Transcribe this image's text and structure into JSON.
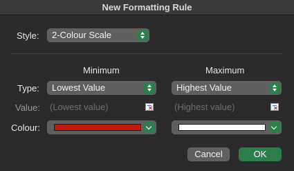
{
  "window": {
    "title": "New Formatting Rule"
  },
  "style": {
    "label": "Style:",
    "value": "2-Colour Scale"
  },
  "columns": {
    "minimum": "Minimum",
    "maximum": "Maximum"
  },
  "rows": {
    "type_label": "Type:",
    "value_label": "Value:",
    "colour_label": "Colour:"
  },
  "minimum": {
    "type": "Lowest Value",
    "value_placeholder": "(Lowest value)",
    "colour": "#c41a12"
  },
  "maximum": {
    "type": "Highest Value",
    "value_placeholder": "(Highest value)",
    "colour": "#ffffff"
  },
  "buttons": {
    "cancel": "Cancel",
    "ok": "OK"
  },
  "colors": {
    "accent": "#2e7d4f",
    "control": "#5f5f5f",
    "background": "#2b2b2b"
  }
}
